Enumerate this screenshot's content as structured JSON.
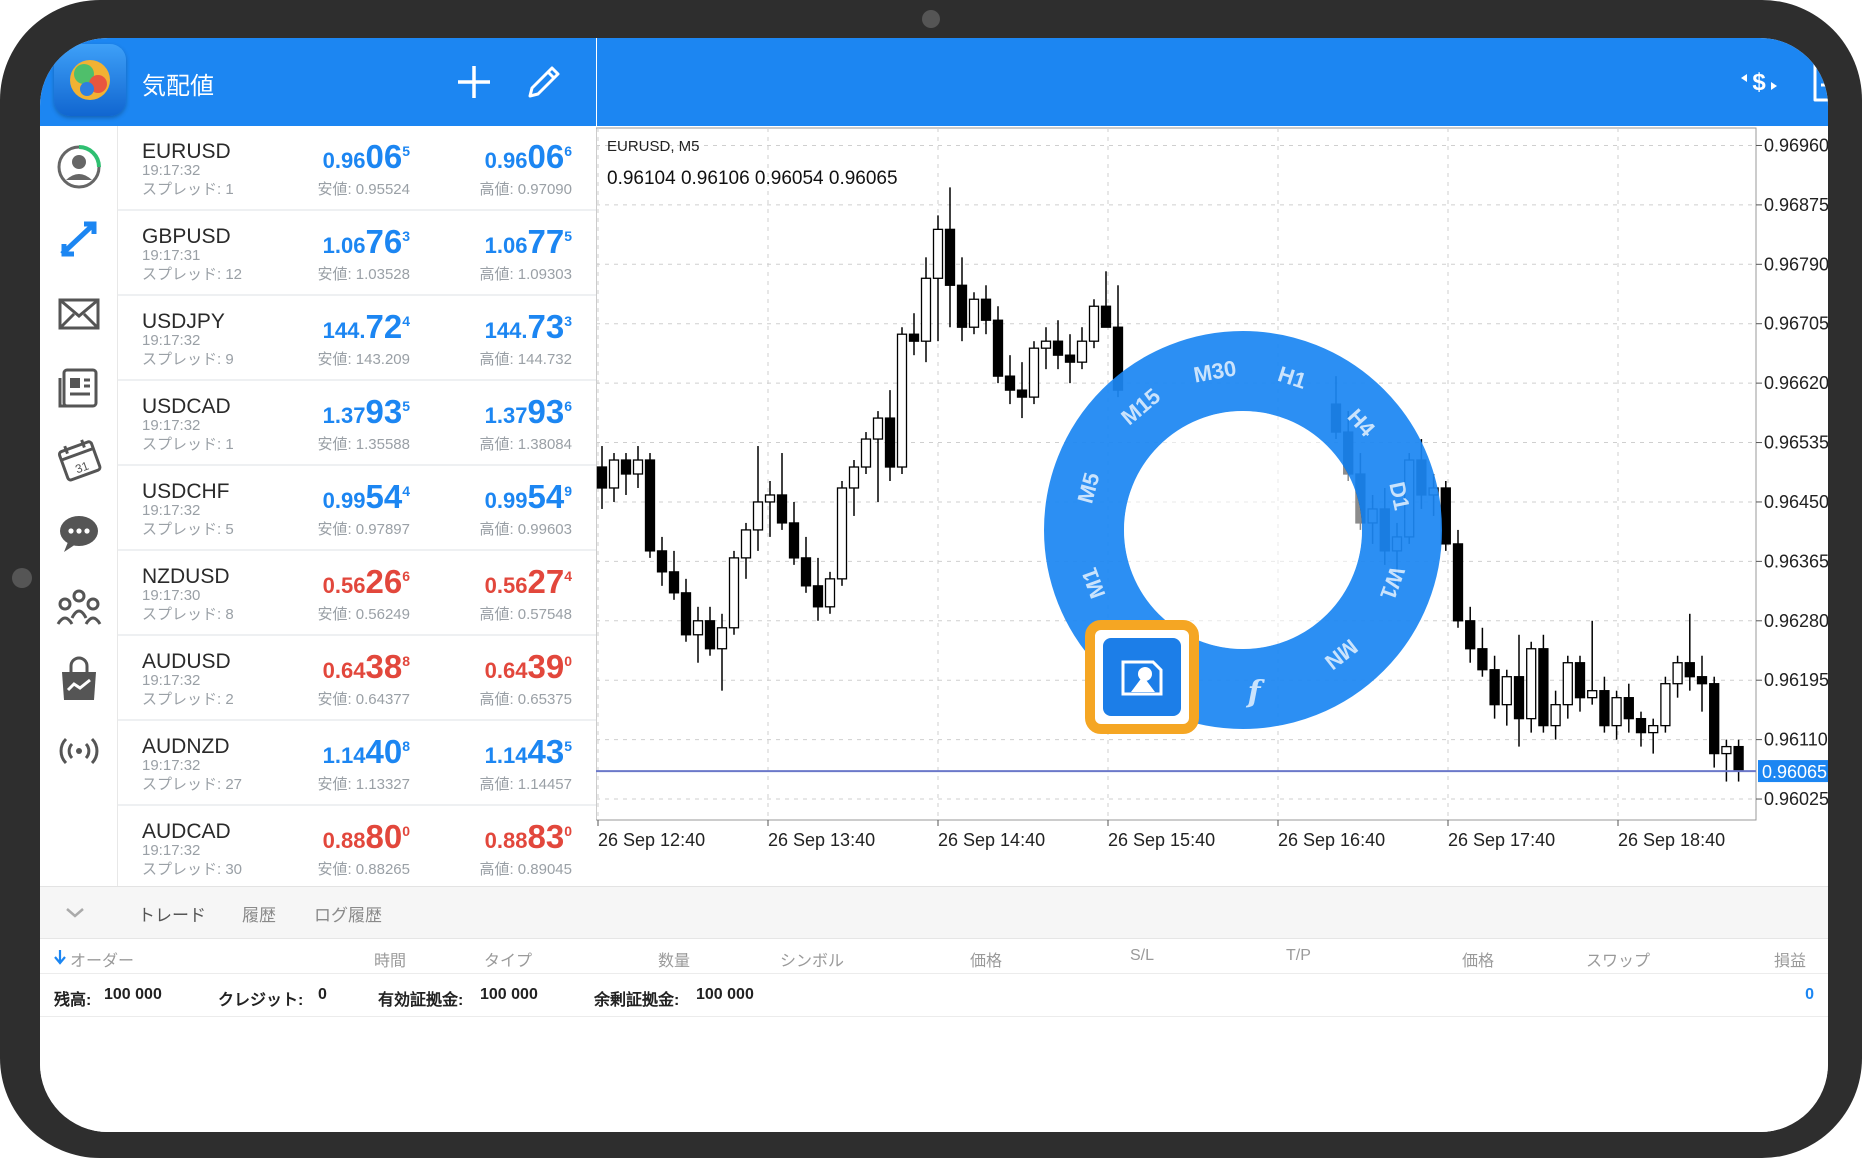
{
  "header": {
    "title": "気配値"
  },
  "quotes": [
    {
      "symbol": "EURUSD",
      "time": "19:17:32",
      "spread": "スプレッド: 1",
      "bid": {
        "pre": "0.96",
        "big": "06",
        "sup": "5"
      },
      "ask": {
        "pre": "0.96",
        "big": "06",
        "sup": "6"
      },
      "low": "安値: 0.95524",
      "high": "高値: 0.97090",
      "color": "#1c86f2"
    },
    {
      "symbol": "GBPUSD",
      "time": "19:17:31",
      "spread": "スプレッド: 12",
      "bid": {
        "pre": "1.06",
        "big": "76",
        "sup": "3"
      },
      "ask": {
        "pre": "1.06",
        "big": "77",
        "sup": "5"
      },
      "low": "安値: 1.03528",
      "high": "高値: 1.09303",
      "color": "#1c86f2"
    },
    {
      "symbol": "USDJPY",
      "time": "19:17:32",
      "spread": "スプレッド: 9",
      "bid": {
        "pre": "144.",
        "big": "72",
        "sup": "4"
      },
      "ask": {
        "pre": "144.",
        "big": "73",
        "sup": "3"
      },
      "low": "安値: 143.209",
      "high": "高値: 144.732",
      "color": "#1c86f2"
    },
    {
      "symbol": "USDCAD",
      "time": "19:17:32",
      "spread": "スプレッド: 1",
      "bid": {
        "pre": "1.37",
        "big": "93",
        "sup": "5"
      },
      "ask": {
        "pre": "1.37",
        "big": "93",
        "sup": "6"
      },
      "low": "安値: 1.35588",
      "high": "高値: 1.38084",
      "color": "#1c86f2"
    },
    {
      "symbol": "USDCHF",
      "time": "19:17:32",
      "spread": "スプレッド: 5",
      "bid": {
        "pre": "0.99",
        "big": "54",
        "sup": "4"
      },
      "ask": {
        "pre": "0.99",
        "big": "54",
        "sup": "9"
      },
      "low": "安値: 0.97897",
      "high": "高値: 0.99603",
      "color": "#1c86f2"
    },
    {
      "symbol": "NZDUSD",
      "time": "19:17:30",
      "spread": "スプレッド: 8",
      "bid": {
        "pre": "0.56",
        "big": "26",
        "sup": "6"
      },
      "ask": {
        "pre": "0.56",
        "big": "27",
        "sup": "4"
      },
      "low": "安値: 0.56249",
      "high": "高値: 0.57548",
      "color": "#e2473c"
    },
    {
      "symbol": "AUDUSD",
      "time": "19:17:32",
      "spread": "スプレッド: 2",
      "bid": {
        "pre": "0.64",
        "big": "38",
        "sup": "8"
      },
      "ask": {
        "pre": "0.64",
        "big": "39",
        "sup": "0"
      },
      "low": "安値: 0.64377",
      "high": "高値: 0.65375",
      "color": "#e2473c"
    },
    {
      "symbol": "AUDNZD",
      "time": "19:17:32",
      "spread": "スプレッド: 27",
      "bid": {
        "pre": "1.14",
        "big": "40",
        "sup": "8"
      },
      "ask": {
        "pre": "1.14",
        "big": "43",
        "sup": "5"
      },
      "low": "安値: 1.13327",
      "high": "高値: 1.14457",
      "color": "#1c86f2"
    },
    {
      "symbol": "AUDCAD",
      "time": "19:17:32",
      "spread": "スプレッド: 30",
      "bid": {
        "pre": "0.88",
        "big": "80",
        "sup": "0"
      },
      "ask": {
        "pre": "0.88",
        "big": "83",
        "sup": "0"
      },
      "low": "安値: 0.88265",
      "high": "高値: 0.89045",
      "color": "#e2473c"
    }
  ],
  "chart": {
    "title": "EURUSD, M5",
    "ohlc": "0.96104 0.96106 0.96054 0.96065"
  },
  "chart_data": {
    "type": "candlestick",
    "title": "EURUSD, M5",
    "y_ticks": [
      "0.96960",
      "0.96875",
      "0.96790",
      "0.96705",
      "0.96620",
      "0.96535",
      "0.96450",
      "0.96365",
      "0.96280",
      "0.96195",
      "0.96110",
      "0.96025"
    ],
    "x_ticks": [
      "26 Sep 12:40",
      "26 Sep 13:40",
      "26 Sep 14:40",
      "26 Sep 15:40",
      "26 Sep 16:40",
      "26 Sep 17:40",
      "26 Sep 18:40"
    ],
    "ylim": [
      0.95995,
      0.96985
    ],
    "current_price": "0.96065",
    "current_price_value": 0.96065,
    "candles": [
      [
        0.965,
        0.9653,
        0.9644,
        0.9647
      ],
      [
        0.9647,
        0.9652,
        0.9645,
        0.9651
      ],
      [
        0.9651,
        0.9652,
        0.9646,
        0.9649
      ],
      [
        0.9649,
        0.9653,
        0.9647,
        0.9651
      ],
      [
        0.9651,
        0.9652,
        0.9637,
        0.9638
      ],
      [
        0.9638,
        0.964,
        0.9633,
        0.9635
      ],
      [
        0.9635,
        0.9638,
        0.9631,
        0.9632
      ],
      [
        0.9632,
        0.9634,
        0.9625,
        0.9626
      ],
      [
        0.9626,
        0.963,
        0.9622,
        0.9628
      ],
      [
        0.9628,
        0.963,
        0.9623,
        0.9624
      ],
      [
        0.9624,
        0.9629,
        0.9618,
        0.9627
      ],
      [
        0.9627,
        0.9638,
        0.9626,
        0.9637
      ],
      [
        0.9637,
        0.9642,
        0.9634,
        0.9641
      ],
      [
        0.9641,
        0.9653,
        0.9638,
        0.9645
      ],
      [
        0.9645,
        0.9648,
        0.964,
        0.9646
      ],
      [
        0.9646,
        0.9652,
        0.9641,
        0.9642
      ],
      [
        0.9642,
        0.9645,
        0.9636,
        0.9637
      ],
      [
        0.9637,
        0.964,
        0.9632,
        0.9633
      ],
      [
        0.9633,
        0.9637,
        0.9628,
        0.963
      ],
      [
        0.963,
        0.9635,
        0.9629,
        0.9634
      ],
      [
        0.9634,
        0.9648,
        0.9633,
        0.9647
      ],
      [
        0.9647,
        0.9651,
        0.9643,
        0.965
      ],
      [
        0.965,
        0.9655,
        0.9649,
        0.9654
      ],
      [
        0.9654,
        0.9658,
        0.9645,
        0.9657
      ],
      [
        0.9657,
        0.9661,
        0.9648,
        0.965
      ],
      [
        0.965,
        0.967,
        0.9649,
        0.9669
      ],
      [
        0.9669,
        0.9672,
        0.9666,
        0.9668
      ],
      [
        0.9668,
        0.968,
        0.9665,
        0.9677
      ],
      [
        0.9677,
        0.9686,
        0.9668,
        0.9684
      ],
      [
        0.9684,
        0.969,
        0.967,
        0.9676
      ],
      [
        0.9676,
        0.968,
        0.9668,
        0.967
      ],
      [
        0.967,
        0.9675,
        0.9669,
        0.9674
      ],
      [
        0.9674,
        0.9676,
        0.9669,
        0.9671
      ],
      [
        0.9671,
        0.9673,
        0.9662,
        0.9663
      ],
      [
        0.9663,
        0.9666,
        0.9659,
        0.9661
      ],
      [
        0.9661,
        0.9665,
        0.9657,
        0.966
      ],
      [
        0.966,
        0.9668,
        0.9659,
        0.9667
      ],
      [
        0.9667,
        0.967,
        0.9664,
        0.9668
      ],
      [
        0.9668,
        0.9671,
        0.9664,
        0.9666
      ],
      [
        0.9666,
        0.9669,
        0.9662,
        0.9665
      ],
      [
        0.9665,
        0.967,
        0.9664,
        0.9668
      ],
      [
        0.9668,
        0.9674,
        0.9667,
        0.9673
      ],
      [
        0.9673,
        0.9678,
        0.967,
        0.967
      ],
      [
        0.967,
        0.9676,
        0.966,
        0.9661
      ]
    ],
    "candles_after_menu": [
      [
        0.9659,
        0.9663,
        0.9654,
        0.9655
      ],
      [
        0.9655,
        0.9658,
        0.9648,
        0.9649
      ],
      [
        0.9649,
        0.9652,
        0.9641,
        0.9642
      ],
      [
        0.9642,
        0.9646,
        0.9639,
        0.9644
      ],
      [
        0.9644,
        0.9647,
        0.9636,
        0.9638
      ],
      [
        0.9638,
        0.9642,
        0.9633,
        0.964
      ],
      [
        0.964,
        0.9652,
        0.9639,
        0.9651
      ],
      [
        0.9651,
        0.9654,
        0.9644,
        0.9646
      ],
      [
        0.9646,
        0.9649,
        0.9643,
        0.9647
      ],
      [
        0.9647,
        0.9648,
        0.9638,
        0.9639
      ],
      [
        0.9639,
        0.9641,
        0.9627,
        0.9628
      ],
      [
        0.9628,
        0.963,
        0.9622,
        0.9624
      ],
      [
        0.9624,
        0.9627,
        0.962,
        0.9621
      ],
      [
        0.9621,
        0.9623,
        0.9614,
        0.9616
      ],
      [
        0.9616,
        0.9621,
        0.9613,
        0.962
      ],
      [
        0.962,
        0.9626,
        0.961,
        0.9614
      ],
      [
        0.9614,
        0.9625,
        0.9612,
        0.9624
      ],
      [
        0.9624,
        0.9626,
        0.9612,
        0.9613
      ],
      [
        0.9613,
        0.9618,
        0.9611,
        0.9616
      ],
      [
        0.9616,
        0.9623,
        0.9614,
        0.9622
      ],
      [
        0.9622,
        0.9623,
        0.9615,
        0.9617
      ],
      [
        0.9617,
        0.9628,
        0.9616,
        0.9618
      ],
      [
        0.9618,
        0.962,
        0.9612,
        0.9613
      ],
      [
        0.9613,
        0.9618,
        0.9611,
        0.9617
      ],
      [
        0.9617,
        0.9619,
        0.9612,
        0.9614
      ],
      [
        0.9614,
        0.9615,
        0.961,
        0.9612
      ],
      [
        0.9612,
        0.9614,
        0.9609,
        0.9613
      ],
      [
        0.9613,
        0.962,
        0.9612,
        0.9619
      ],
      [
        0.9619,
        0.9623,
        0.9617,
        0.9622
      ],
      [
        0.9622,
        0.9629,
        0.9618,
        0.962
      ],
      [
        0.962,
        0.9623,
        0.9615,
        0.9619
      ],
      [
        0.9619,
        0.962,
        0.9607,
        0.9609
      ],
      [
        0.9609,
        0.9611,
        0.9605,
        0.961
      ],
      [
        0.961,
        0.9611,
        0.9605,
        0.96065
      ]
    ]
  },
  "radial_menu": {
    "labels": [
      "M5",
      "M15",
      "M30",
      "H1",
      "H4",
      "D1",
      "W1",
      "MN",
      "f",
      "+",
      "M1"
    ],
    "highlight_icon": "object-shapes-icon"
  },
  "bottom": {
    "tabs": [
      "トレード",
      "履歴",
      "ログ履歴"
    ],
    "columns": [
      "オーダー",
      "時間",
      "タイプ",
      "数量",
      "シンボル",
      "価格",
      "S/L",
      "T/P",
      "価格",
      "スワップ",
      "損益"
    ],
    "account": {
      "balance_label": "残高:",
      "balance": "100 000",
      "credit_label": "クレジット:",
      "credit": "0",
      "equity_label": "有効証拠金:",
      "equity": "100 000",
      "free_label": "余剰証拠金:",
      "free": "100 000",
      "profit": "0"
    }
  },
  "colors": {
    "accent": "#1c86f2",
    "down": "#e2473c",
    "highlight": "#f5a623"
  }
}
